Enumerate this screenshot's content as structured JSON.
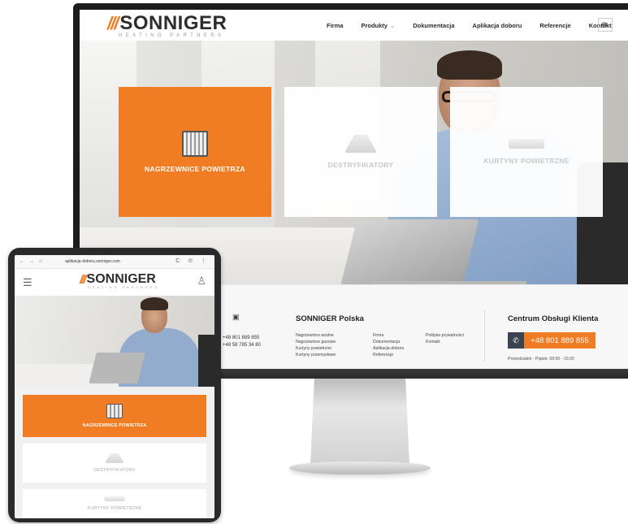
{
  "brand": {
    "mark": "///",
    "name": "SONNIGER",
    "tagline": "HEATING PARTNERS",
    "accent_color": "#f07c24"
  },
  "desktop": {
    "nav": {
      "items": [
        "Firma",
        "Produkty",
        "Dokumentacja",
        "Aplikacja doboru",
        "Referencje",
        "Kontakt"
      ],
      "products_chevron": "⌄",
      "language": "PL"
    },
    "tiles": [
      {
        "label": "NAGRZEWNICE POWIETRZA",
        "icon": "heater-icon",
        "active": true
      },
      {
        "label": "DESTRYFIKATORY",
        "icon": "destratifier-icon",
        "active": false
      },
      {
        "label": "KURTYNY POWIETRZNE",
        "icon": "air-curtain-icon",
        "active": false
      }
    ],
    "footer": {
      "social_icon": "youtube-icon",
      "phone_1": "+48 801 889 855",
      "phone_2": "+48 58 785 34 80",
      "company_title": "SONNIGER Polska",
      "links_col_1": [
        "Nagrzewnice wodne",
        "Nagrzewnice gazowe",
        "Kurtyny powietrzne",
        "Kurtyny przemysłowe"
      ],
      "links_col_2": [
        "Firma",
        "Dokumentacja",
        "Aplikacja doboru",
        "Referencje"
      ],
      "links_col_3": [
        "Polityka prywatności",
        "Kontakt"
      ],
      "service_title": "Centrum Obsługi Klienta",
      "call_icon": "phone-icon",
      "service_phone": "+48 801 889 855",
      "hours": "Poniedziałek - Piątek: 08:00 - 16:00"
    }
  },
  "tablet": {
    "browser": {
      "back": "←",
      "forward": "→",
      "home": "⌂",
      "url": "aplikacja-doboru.sonniger.com",
      "actions": "C ⊙ ⋮"
    },
    "menu_icon": "hamburger-icon",
    "user_icon": "user-icon",
    "tiles": [
      {
        "label": "NAGRZEWNICE POWIETRZA"
      },
      {
        "label": "DESTRYFIKATORY"
      },
      {
        "label": "KURTYNY POWIETRZNE"
      }
    ]
  }
}
